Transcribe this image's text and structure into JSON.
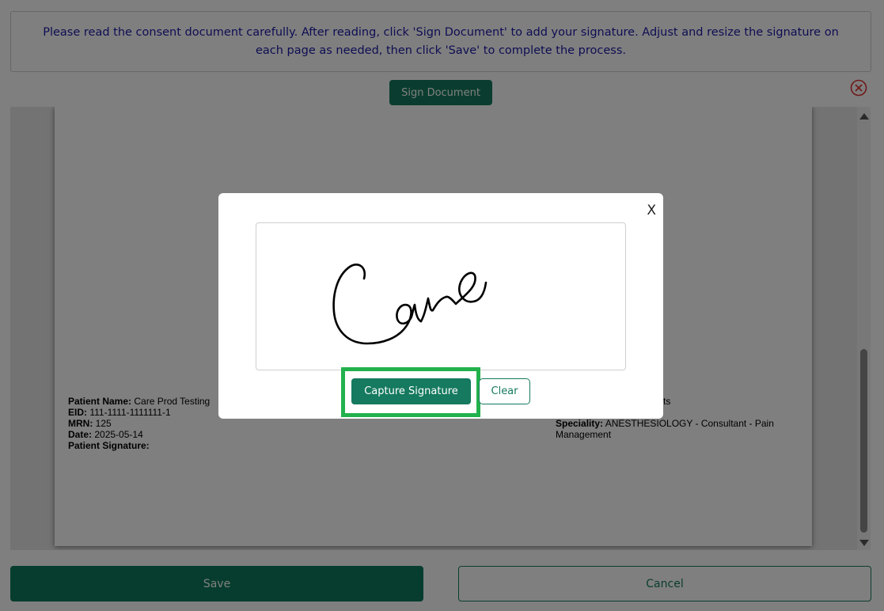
{
  "instructions": {
    "text": "Please read the consent document carefully. After reading, click 'Sign Document' to add your signature. Adjust and resize the signature on each page as needed, then click 'Save' to complete the process."
  },
  "toolbar": {
    "sign_document_label": "Sign Document",
    "close_icon": "close-circle-icon"
  },
  "document": {
    "patient": {
      "name_label": "Patient Name:",
      "name_value": "Care Prod Testing",
      "eid_label": "EID:",
      "eid_value": "111-1111-1111111-1",
      "mrn_label": "MRN:",
      "mrn_value": "125",
      "date_label": "Date:",
      "date_value": "2025-05-14",
      "signature_label": "Patient Signature:"
    },
    "doctor": {
      "name_fragment": "rts",
      "speciality_label": "Speciality:",
      "speciality_value": "ANESTHESIOLOGY - Consultant - Pain Management"
    }
  },
  "footer": {
    "save_label": "Save",
    "cancel_label": "Cancel"
  },
  "modal": {
    "close_label": "X",
    "signature_text": "Care",
    "capture_label": "Capture Signature",
    "clear_label": "Clear"
  },
  "colors": {
    "primary": "#157a5f",
    "highlight": "#22b14c",
    "instruction_text": "#1a1aa6",
    "danger": "#e03030"
  }
}
